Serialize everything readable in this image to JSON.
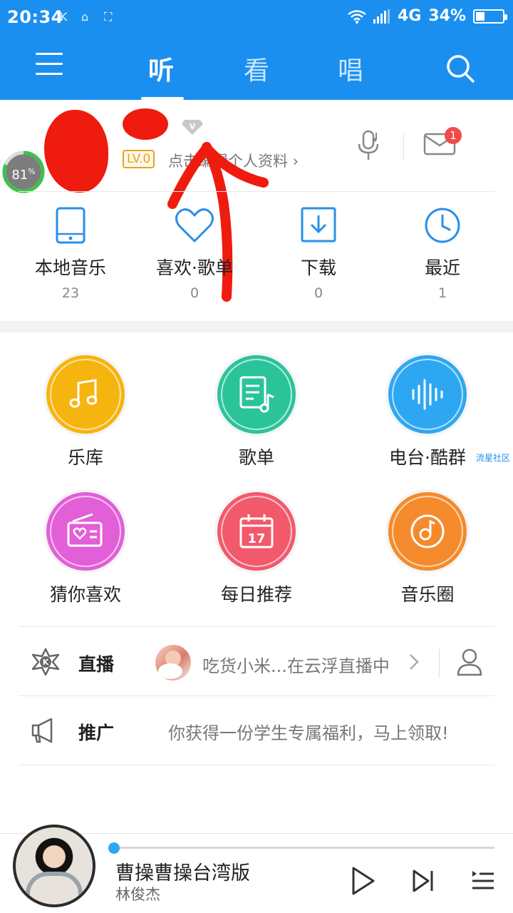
{
  "status_bar": {
    "time": "20:34",
    "network": "4G",
    "battery": "34%",
    "battery_level": 0.34
  },
  "nav": {
    "tabs": [
      "听",
      "看",
      "唱"
    ],
    "active_tab": "听"
  },
  "profile": {
    "ring_value": "81",
    "ring_unit": "%",
    "level": "LV.0",
    "edit_prompt": "点击编辑个人资料",
    "mail_badge": "1"
  },
  "quick_stats": [
    {
      "label": "本地音乐",
      "count": "23",
      "icon": "tablet-icon"
    },
    {
      "label": "喜欢·歌单",
      "count": "0",
      "icon": "heart-icon"
    },
    {
      "label": "下载",
      "count": "0",
      "icon": "download-icon"
    },
    {
      "label": "最近",
      "count": "1",
      "icon": "clock-icon"
    }
  ],
  "features": [
    {
      "label": "乐库",
      "color": "#f6b40e",
      "icon": "music-note-icon"
    },
    {
      "label": "歌单",
      "color": "#2bc49a",
      "icon": "playlist-icon"
    },
    {
      "label": "电台·酷群",
      "color": "#2ea7f2",
      "icon": "soundwave-icon"
    },
    {
      "label": "猜你喜欢",
      "color": "#e25fd8",
      "icon": "radio-heart-icon"
    },
    {
      "label": "每日推荐",
      "color": "#f2596b",
      "icon": "calendar-icon",
      "date": "17"
    },
    {
      "label": "音乐圈",
      "color": "#f58a2c",
      "icon": "music-circle-icon"
    }
  ],
  "side_tag": "流星社区",
  "live": {
    "title": "直播",
    "text": "吃货小米...在云浮直播中"
  },
  "promo": {
    "title": "推广",
    "text": "你获得一份学生专属福利，马上领取!"
  },
  "player": {
    "song": "曹操曹操台湾版",
    "artist": "林俊杰",
    "progress": 0.0
  }
}
